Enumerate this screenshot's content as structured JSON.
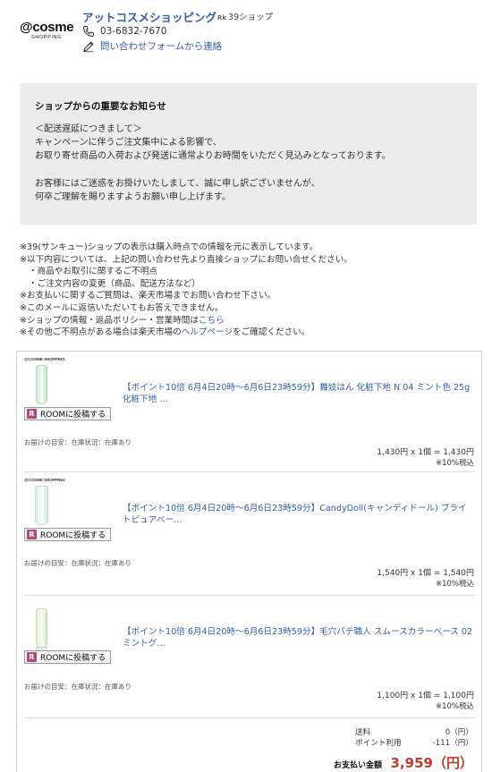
{
  "header": {
    "logo_main": "@cosme",
    "logo_sub": "SHOPPING",
    "shop_name": "アットコスメショッピング",
    "badge_mark": "Rk",
    "badge_text": "39ショップ",
    "phone": "03-6832-7670",
    "contact_form_link": "問い合わせフォームから連絡"
  },
  "notice": {
    "title": "ショップからの重要なお知らせ",
    "lines": [
      "＜配送遅延につきまして＞",
      "キャンペーンに伴うご注文集中による影響で、",
      "お取り寄せ商品の入荷および発送に通常よりお時間をいただく見込みとなっております。",
      "お客様にはご迷惑をお掛けいたしまして、誠に申し訳ございませんが、",
      "何卒ご理解を賜りますようお願い申し上げます。"
    ]
  },
  "notes": {
    "l1": "※39(サンキュー)ショップの表示は購入時点での情報を元に表示しています。",
    "l2": "※以下内容については、上記の問い合わせ先より直接ショップにお問い合せください。",
    "l3": "・商品やお取引に関するご不明点",
    "l4": "・ご注文内容の変更（商品、配送方法など）",
    "l5": "※お支払いに関するご質問は、楽天市場までお問い合わせ下さい。",
    "l6": "※このメールに返信いただいてもお答えできません。",
    "l7_prefix": "※ショップの情報・返品ポリシー・営業時間は",
    "l7_link": "こちら",
    "l8_prefix": "※その他ご不明点がある場合は楽天市場の",
    "l8_link": "ヘルプページ",
    "l8_suffix": "をご確認ください。"
  },
  "items": [
    {
      "thumb_brand": "@COSME SHOPPING",
      "title": "【ポイント10倍 6月4日20時〜6月6日23時59分】舞妓はん 化粧下地 N 04 ミント色 25g 化粧下地 …",
      "room_button": "ROOMに投稿する",
      "room_icon": "R",
      "delivery": "お届けの目安：在庫状況：在庫あり",
      "price": "1,430円 x 1個 = 1,430円",
      "tax": "※10%税込"
    },
    {
      "thumb_brand": "@COSME SHOPPING",
      "title": "【ポイント10倍 6月4日20時〜6月6日23時59分】CandyDoll(キャンディドール) ブライトピュアベー…",
      "room_button": "ROOMに投稿する",
      "room_icon": "R",
      "delivery": "お届けの目安：在庫状況：在庫あり",
      "price": "1,540円 x 1個 = 1,540円",
      "tax": "※10%税込"
    },
    {
      "thumb_brand": "@COSME SHOPPING",
      "title": "【ポイント10倍 6月4日20時〜6月6日23時59分】毛穴パテ職人 スムースカラーベース 02 ミントグ…",
      "room_button": "ROOMに投稿する",
      "room_icon": "R",
      "delivery": "お届けの目安：在庫状況：在庫あり",
      "price": "1,100円 x 1個 = 1,100円",
      "tax": "※10%税込"
    }
  ],
  "totals": {
    "shipping_label": "送料",
    "shipping_value": "0（円）",
    "points_label": "ポイント利用",
    "points_value": "-111（円）",
    "grand_label": "お支払い金額",
    "grand_value": "3,959（円）"
  },
  "colors": {
    "link": "#2f5fa7",
    "notice_bg": "#ebebeb",
    "grand_total": "#c0392b",
    "room_icon": "#b5477a"
  }
}
